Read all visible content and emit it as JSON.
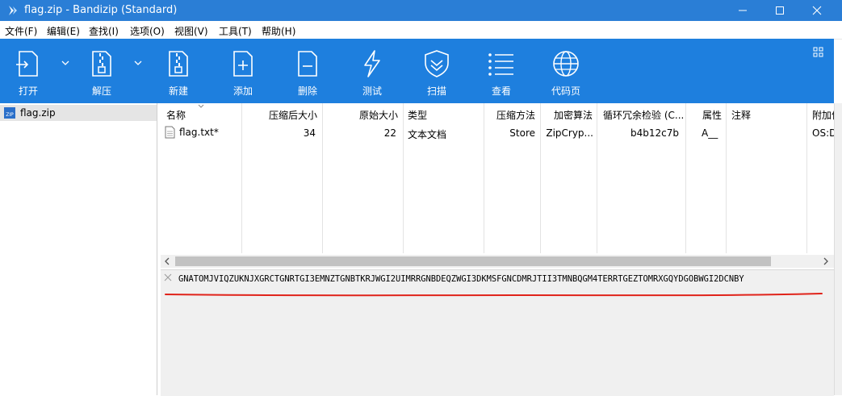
{
  "window": {
    "title": "flag.zip - Bandizip (Standard)",
    "minimize_icon": "minimize-icon",
    "maximize_icon": "maximize-icon",
    "close_icon": "close-icon"
  },
  "menu": [
    {
      "label": "文件(F)"
    },
    {
      "label": "编辑(E)"
    },
    {
      "label": "查找(I)"
    },
    {
      "label": "选项(O)"
    },
    {
      "label": "视图(V)"
    },
    {
      "label": "工具(T)"
    },
    {
      "label": "帮助(H)"
    }
  ],
  "toolbar": [
    {
      "label": "打开",
      "icon": "open-icon"
    },
    {
      "label": "解压",
      "icon": "extract-icon"
    },
    {
      "label": "新建",
      "icon": "new-archive-icon"
    },
    {
      "label": "添加",
      "icon": "add-file-icon"
    },
    {
      "label": "删除",
      "icon": "delete-file-icon"
    },
    {
      "label": "测试",
      "icon": "test-icon"
    },
    {
      "label": "扫描",
      "icon": "scan-icon"
    },
    {
      "label": "查看",
      "icon": "view-icon"
    },
    {
      "label": "代码页",
      "icon": "codepage-icon"
    }
  ],
  "tree": {
    "root": "flag.zip"
  },
  "columns": [
    "名称",
    "压缩后大小",
    "原始大小",
    "类型",
    "压缩方法",
    "加密算法",
    "循环冗余检验 (C...",
    "属性",
    "注释",
    "附加信"
  ],
  "files": [
    {
      "name": "flag.txt*",
      "compressed": "34",
      "original": "22",
      "type": "文本文档",
      "method": "Store",
      "encryption": "ZipCryp...",
      "crc": "b4b12c7b",
      "attr": "A__",
      "comment": "",
      "extra": "OS:D"
    }
  ],
  "comment_text": "GNATOMJVIQZUKNJXGRCTGNRTGI3EMNZTGNBTKRJWGI2UIMRRGNBDEQZWGI3DKMSFGNCDMRJTII3TMNBQGM4TERRTGEZTOMRXGQYDGOBWGI2DCNBY",
  "colors": {
    "titlebar": "#2a7ed6",
    "toolbar": "#1e7fde",
    "underline": "#e0231a"
  }
}
